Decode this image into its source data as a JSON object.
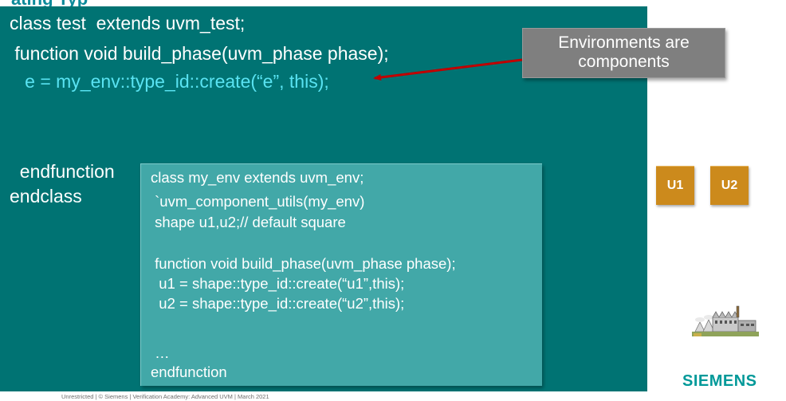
{
  "title_fragment": "ating Typ",
  "test_code": {
    "line1": "class test  extends uvm_test;",
    "line2": " function void build_phase(uvm_phase phase);",
    "line3": "   e = my_env::type_id::create(“e”, this);",
    "endfunction": "  endfunction",
    "endclass": "endclass"
  },
  "callout": {
    "line1": "Environments are",
    "line2": "components"
  },
  "env_code": {
    "line1": "class my_env extends uvm_env;",
    "line2": " `uvm_component_utils(my_env)",
    "line3": " shape u1,u2;// default square",
    "line4": " function void build_phase(uvm_phase phase);",
    "line5": "  u1 = shape::type_id::create(“u1”,this);",
    "line6": "  u2 = shape::type_id::create(“u2”,this);",
    "line7": " …",
    "line8": "endfunction"
  },
  "components": {
    "u1": "U1",
    "u2": "U2"
  },
  "factory_icon": "factory-icon",
  "logo": "SIEMENS",
  "footer": "Unrestricted | © Siemens | Verification Academy: Advanced UVM | March 2021",
  "colors": {
    "main_panel": "#007373",
    "env_panel": "#42a8a8",
    "accent_text": "#59e3f2",
    "callout": "#7f7f7f",
    "arrow": "#c00000",
    "component_box": "#cc8a1c",
    "logo": "#009999"
  }
}
